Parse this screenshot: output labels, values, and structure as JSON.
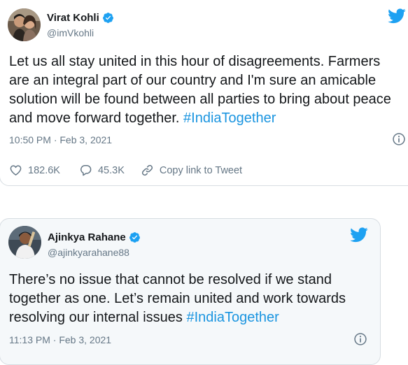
{
  "tweets": [
    {
      "name": "Virat Kohli",
      "handle": "@imVkohli",
      "text": "Let us all stay united in this hour of disagreements. Farmers are an integral part of our country and I'm sure an amicable solution will be found between all parties to bring about peace and move forward together. ",
      "hashtag": "#IndiaTogether",
      "timestamp": "10:50 PM · Feb 3, 2021",
      "likes": "182.6K",
      "replies": "45.3K",
      "copy_link": "Copy link to Tweet"
    },
    {
      "name": "Ajinkya Rahane",
      "handle": "@ajinkyarahane88",
      "text": "There’s no issue that cannot be resolved if we stand together as one. Let’s remain united and work towards resolving our internal issues ",
      "hashtag": "#IndiaTogether",
      "timestamp": "11:13 PM · Feb 3, 2021"
    }
  ],
  "icons": {
    "verified": "verified-badge-icon",
    "twitter": "twitter-bird-icon",
    "info": "info-icon",
    "like": "heart-icon",
    "reply": "reply-bubble-icon",
    "link": "link-icon"
  },
  "colors": {
    "twitter_blue": "#1da1f2",
    "hashtag": "#1b95e0",
    "muted_text": "#657786",
    "card_border": "#d7dde2",
    "card2_background": "#f5f8fa"
  }
}
